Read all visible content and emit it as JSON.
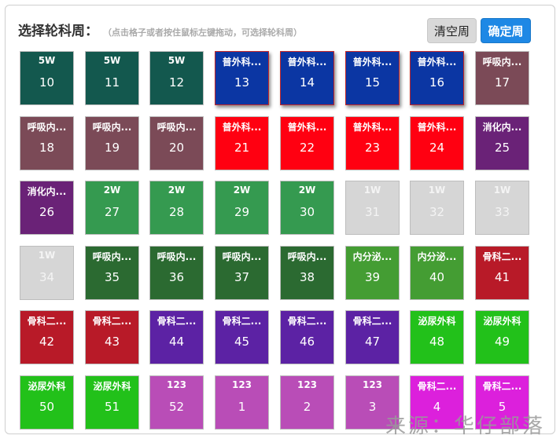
{
  "header": {
    "title": "选择轮科周：",
    "hint": "（点击格子或者按住鼠标左键拖动，可选择轮科周）"
  },
  "buttons": {
    "clear": "清空周",
    "confirm": "确定周"
  },
  "colors": {
    "dark_teal": "#13584e",
    "blue": "#0b36a3",
    "mauve": "#7b4a57",
    "red": "#ff0011",
    "purple": "#6a2277",
    "green": "#359a50",
    "light_gray": "#d6d6d6",
    "dark_green": "#2b6a31",
    "mid_green": "#449d33",
    "crimson": "#b81a28",
    "violet": "#5c22a4",
    "bright_green": "#22c11a",
    "orchid": "#b94db7",
    "magenta": "#dc20dc"
  },
  "cells": [
    {
      "label": "5W",
      "num": "10",
      "color": "#13584e"
    },
    {
      "label": "5W",
      "num": "11",
      "color": "#13584e"
    },
    {
      "label": "5W",
      "num": "12",
      "color": "#13584e"
    },
    {
      "label": "普外科...",
      "num": "13",
      "color": "#0b36a3",
      "selected": true
    },
    {
      "label": "普外科...",
      "num": "14",
      "color": "#0b36a3",
      "selected": true
    },
    {
      "label": "普外科...",
      "num": "15",
      "color": "#0b36a3",
      "selected": true
    },
    {
      "label": "普外科...",
      "num": "16",
      "color": "#0b36a3",
      "selected": true
    },
    {
      "label": "呼吸内...",
      "num": "17",
      "color": "#7b4a57"
    },
    {
      "label": "呼吸内...",
      "num": "18",
      "color": "#7b4a57"
    },
    {
      "label": "呼吸内...",
      "num": "19",
      "color": "#7b4a57"
    },
    {
      "label": "呼吸内...",
      "num": "20",
      "color": "#7b4a57"
    },
    {
      "label": "普外科...",
      "num": "21",
      "color": "#ff0011"
    },
    {
      "label": "普外科...",
      "num": "22",
      "color": "#ff0011"
    },
    {
      "label": "普外科...",
      "num": "23",
      "color": "#ff0011"
    },
    {
      "label": "普外科...",
      "num": "24",
      "color": "#ff0011"
    },
    {
      "label": "消化内...",
      "num": "25",
      "color": "#6a2277"
    },
    {
      "label": "消化内...",
      "num": "26",
      "color": "#6a2277"
    },
    {
      "label": "2W",
      "num": "27",
      "color": "#359a50"
    },
    {
      "label": "2W",
      "num": "28",
      "color": "#359a50"
    },
    {
      "label": "2W",
      "num": "29",
      "color": "#359a50"
    },
    {
      "label": "2W",
      "num": "30",
      "color": "#359a50"
    },
    {
      "label": "1W",
      "num": "31",
      "color": "#d6d6d6"
    },
    {
      "label": "1W",
      "num": "32",
      "color": "#d6d6d6"
    },
    {
      "label": "1W",
      "num": "33",
      "color": "#d6d6d6"
    },
    {
      "label": "1W",
      "num": "34",
      "color": "#d6d6d6"
    },
    {
      "label": "呼吸内...",
      "num": "35",
      "color": "#2b6a31"
    },
    {
      "label": "呼吸内...",
      "num": "36",
      "color": "#2b6a31"
    },
    {
      "label": "呼吸内...",
      "num": "37",
      "color": "#2b6a31"
    },
    {
      "label": "呼吸内...",
      "num": "38",
      "color": "#2b6a31"
    },
    {
      "label": "内分泌...",
      "num": "39",
      "color": "#449d33"
    },
    {
      "label": "内分泌...",
      "num": "40",
      "color": "#449d33"
    },
    {
      "label": "骨科二...",
      "num": "41",
      "color": "#b81a28"
    },
    {
      "label": "骨科二...",
      "num": "42",
      "color": "#b81a28"
    },
    {
      "label": "骨科二...",
      "num": "43",
      "color": "#b81a28"
    },
    {
      "label": "骨科二...",
      "num": "44",
      "color": "#5c22a4"
    },
    {
      "label": "骨科二...",
      "num": "45",
      "color": "#5c22a4"
    },
    {
      "label": "骨科二...",
      "num": "46",
      "color": "#5c22a4"
    },
    {
      "label": "骨科二...",
      "num": "47",
      "color": "#5c22a4"
    },
    {
      "label": "泌尿外科",
      "num": "48",
      "color": "#22c11a"
    },
    {
      "label": "泌尿外科",
      "num": "49",
      "color": "#22c11a"
    },
    {
      "label": "泌尿外科",
      "num": "50",
      "color": "#22c11a"
    },
    {
      "label": "泌尿外科",
      "num": "51",
      "color": "#22c11a"
    },
    {
      "label": "123",
      "num": "52",
      "color": "#b94db7"
    },
    {
      "label": "123",
      "num": "1",
      "color": "#b94db7"
    },
    {
      "label": "123",
      "num": "2",
      "color": "#b94db7"
    },
    {
      "label": "123",
      "num": "3",
      "color": "#b94db7"
    },
    {
      "label": "骨科二...",
      "num": "4",
      "color": "#dc20dc"
    },
    {
      "label": "骨科二...",
      "num": "5",
      "color": "#dc20dc"
    }
  ],
  "watermark": "来源：华仔部落"
}
